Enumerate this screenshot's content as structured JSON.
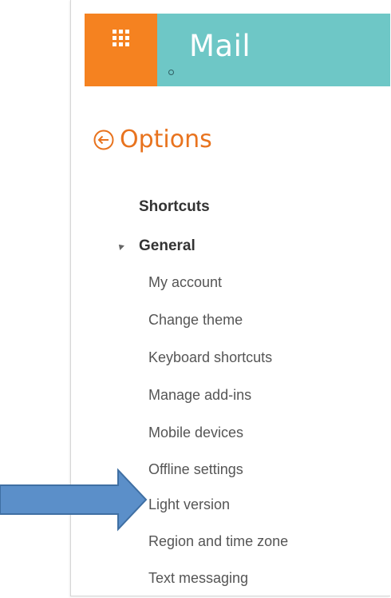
{
  "header": {
    "app_name": "Mail"
  },
  "options": {
    "title": "Options"
  },
  "nav": {
    "sections": [
      {
        "label": "Shortcuts"
      },
      {
        "label": "General"
      }
    ],
    "general_items": [
      {
        "label": "My account"
      },
      {
        "label": "Change theme"
      },
      {
        "label": "Keyboard shortcuts"
      },
      {
        "label": "Manage add-ins"
      },
      {
        "label": "Mobile devices"
      },
      {
        "label": "Offline settings"
      },
      {
        "label": "Light version"
      },
      {
        "label": "Region and time zone"
      },
      {
        "label": "Text messaging"
      }
    ]
  },
  "annotation": {
    "highlighted_item": "Light version"
  },
  "colors": {
    "launcher": "#f58220",
    "banner": "#6ec7c6",
    "accent": "#e8731e",
    "arrow_fill": "#5b8fc9",
    "arrow_stroke": "#3f6fa3"
  },
  "icons": {
    "launcher": "app-launcher-waffle-icon",
    "back": "back-arrow-circle-icon",
    "collapse": "collapse-triangle-icon",
    "pointer": "pointer-arrow-icon"
  }
}
